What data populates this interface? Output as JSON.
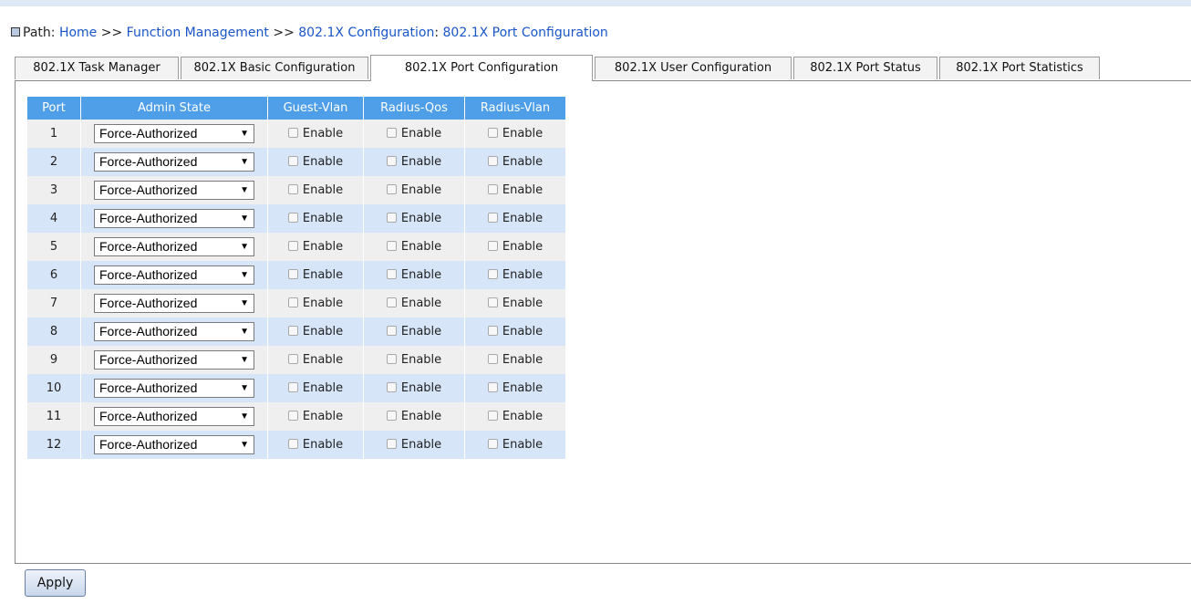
{
  "breadcrumb": {
    "prefix": "Path:",
    "items": [
      "Home",
      "Function Management",
      "802.1X Configuration",
      "802.1X Port Configuration"
    ],
    "sep1": ">>",
    "sep2": ">>",
    "sep3": ":"
  },
  "tabs": [
    {
      "label": "802.1X Task Manager"
    },
    {
      "label": "802.1X Basic Configuration"
    },
    {
      "label": "802.1X Port Configuration",
      "active": true
    },
    {
      "label": "802.1X User Configuration"
    },
    {
      "label": "802.1X Port Status"
    },
    {
      "label": "802.1X Port Statistics"
    }
  ],
  "table": {
    "headers": [
      "Port",
      "Admin State",
      "Guest-Vlan",
      "Radius-Qos",
      "Radius-Vlan"
    ],
    "enable_label": "Enable",
    "rows": [
      {
        "port": "1",
        "admin_state": "Force-Authorized",
        "guest_vlan": false,
        "radius_qos": false,
        "radius_vlan": false
      },
      {
        "port": "2",
        "admin_state": "Force-Authorized",
        "guest_vlan": false,
        "radius_qos": false,
        "radius_vlan": false
      },
      {
        "port": "3",
        "admin_state": "Force-Authorized",
        "guest_vlan": false,
        "radius_qos": false,
        "radius_vlan": false
      },
      {
        "port": "4",
        "admin_state": "Force-Authorized",
        "guest_vlan": false,
        "radius_qos": false,
        "radius_vlan": false
      },
      {
        "port": "5",
        "admin_state": "Force-Authorized",
        "guest_vlan": false,
        "radius_qos": false,
        "radius_vlan": false
      },
      {
        "port": "6",
        "admin_state": "Force-Authorized",
        "guest_vlan": false,
        "radius_qos": false,
        "radius_vlan": false
      },
      {
        "port": "7",
        "admin_state": "Force-Authorized",
        "guest_vlan": false,
        "radius_qos": false,
        "radius_vlan": false
      },
      {
        "port": "8",
        "admin_state": "Force-Authorized",
        "guest_vlan": false,
        "radius_qos": false,
        "radius_vlan": false
      },
      {
        "port": "9",
        "admin_state": "Force-Authorized",
        "guest_vlan": false,
        "radius_qos": false,
        "radius_vlan": false
      },
      {
        "port": "10",
        "admin_state": "Force-Authorized",
        "guest_vlan": false,
        "radius_qos": false,
        "radius_vlan": false
      },
      {
        "port": "11",
        "admin_state": "Force-Authorized",
        "guest_vlan": false,
        "radius_qos": false,
        "radius_vlan": false
      },
      {
        "port": "12",
        "admin_state": "Force-Authorized",
        "guest_vlan": false,
        "radius_qos": false,
        "radius_vlan": false
      }
    ]
  },
  "apply_label": "Apply",
  "colors": {
    "header_blue": "#4f9ee8",
    "row_even": "#d7e5f9",
    "row_odd": "#efefef",
    "link_blue": "#1a56c8"
  }
}
